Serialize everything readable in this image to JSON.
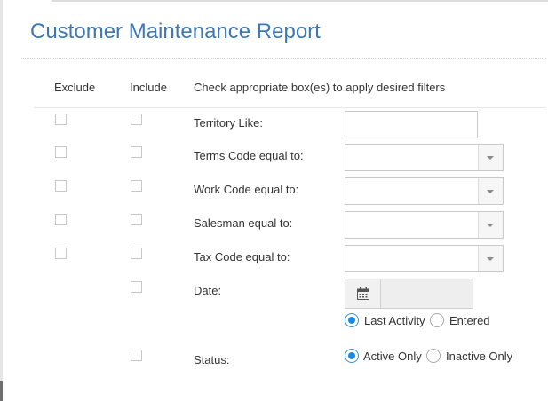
{
  "page": {
    "title": "Customer Maintenance Report"
  },
  "headers": {
    "exclude": "Exclude",
    "include": "Include",
    "instructions": "Check appropriate box(es) to apply desired filters"
  },
  "filters": {
    "territory": {
      "label": "Territory Like:",
      "value": ""
    },
    "terms_code": {
      "label": "Terms Code equal to:",
      "value": ""
    },
    "work_code": {
      "label": "Work Code equal to:",
      "value": ""
    },
    "salesman": {
      "label": "Salesman equal to:",
      "value": ""
    },
    "tax_code": {
      "label": "Tax Code equal to:",
      "value": ""
    },
    "date": {
      "label": "Date:",
      "value": "",
      "icon": "calendar-icon",
      "options": [
        "Last Activity",
        "Entered"
      ],
      "selected": "Last Activity"
    },
    "status": {
      "label": "Status:",
      "options": [
        "Active Only",
        "Inactive Only"
      ],
      "selected": "Active Only"
    }
  },
  "checkboxes": {
    "exclude": {
      "territory": false,
      "terms_code": false,
      "work_code": false,
      "salesman": false,
      "tax_code": false
    },
    "include": {
      "territory": false,
      "terms_code": false,
      "work_code": false,
      "salesman": false,
      "tax_code": false,
      "date": false,
      "status": false
    }
  },
  "colors": {
    "title": "#3d78b4",
    "radio_selected": "#1e88e5",
    "text": "#333333"
  }
}
